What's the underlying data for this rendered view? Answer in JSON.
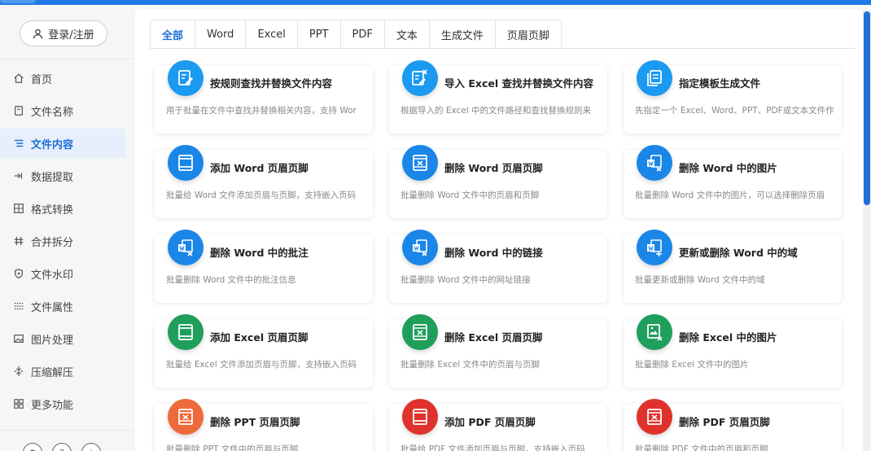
{
  "sidebar": {
    "login_label": "登录/注册",
    "items": [
      {
        "label": "首页",
        "icon": "home-icon",
        "active": false
      },
      {
        "label": "文件名称",
        "icon": "file-icon",
        "active": false
      },
      {
        "label": "文件内容",
        "icon": "list-icon",
        "active": true
      },
      {
        "label": "数据提取",
        "icon": "extract-icon",
        "active": false
      },
      {
        "label": "格式转换",
        "icon": "grid-icon",
        "active": false
      },
      {
        "label": "合并拆分",
        "icon": "hash-icon",
        "active": false
      },
      {
        "label": "文件水印",
        "icon": "shield-icon",
        "active": false
      },
      {
        "label": "文件属性",
        "icon": "lines-icon",
        "active": false
      },
      {
        "label": "图片处理",
        "icon": "image-icon",
        "active": false
      },
      {
        "label": "压缩解压",
        "icon": "compress-icon",
        "active": false
      },
      {
        "label": "更多功能",
        "icon": "more-icon",
        "active": false
      }
    ]
  },
  "tabs": [
    {
      "label": "全部",
      "active": true
    },
    {
      "label": "Word",
      "active": false
    },
    {
      "label": "Excel",
      "active": false
    },
    {
      "label": "PPT",
      "active": false
    },
    {
      "label": "PDF",
      "active": false
    },
    {
      "label": "文本",
      "active": false
    },
    {
      "label": "生成文件",
      "active": false
    },
    {
      "label": "页眉页脚",
      "active": false
    }
  ],
  "cards": [
    {
      "title": "按规则查找并替换文件内容",
      "desc": "用于批量在文件中查找并替换相关内容，支持 Wor",
      "color": "#1a9af0",
      "icon": "edit-doc-icon"
    },
    {
      "title": "导入 Excel 查找并替换文件内容",
      "desc": "根据导入的 Excel 中的文件路径和查找替换规则来",
      "color": "#1a9af0",
      "icon": "excel-edit-icon"
    },
    {
      "title": "指定模板生成文件",
      "desc": "先指定一个 Excel、Word、PPT、PDF或文本文件作",
      "color": "#1a9af0",
      "icon": "template-icon"
    },
    {
      "title": "添加 Word 页眉页脚",
      "desc": "批量给 Word 文件添加页眉与页脚，支持嵌入页码",
      "color": "#1a86e8",
      "icon": "header-footer-icon"
    },
    {
      "title": "删除 Word 页眉页脚",
      "desc": "批量删除 Word 文件中的页眉和页脚",
      "color": "#1a86e8",
      "icon": "delete-header-icon"
    },
    {
      "title": "删除 Word 中的图片",
      "desc": "批量删除 Word 文件中的图片，可以选择删除页眉",
      "color": "#1a86e8",
      "icon": "word-delete-image-icon"
    },
    {
      "title": "删除 Word 中的批注",
      "desc": "批量删除 Word 文件中的批注信息",
      "color": "#1a86e8",
      "icon": "word-delete-comment-icon"
    },
    {
      "title": "删除 Word 中的链接",
      "desc": "批量删除 Word 文件中的网址链接",
      "color": "#1a86e8",
      "icon": "word-delete-link-icon"
    },
    {
      "title": "更新或删除 Word 中的域",
      "desc": "批量更新或删除 Word 文件中的域",
      "color": "#1a86e8",
      "icon": "word-field-icon"
    },
    {
      "title": "添加 Excel 页眉页脚",
      "desc": "批量给 Excel 文件添加页眉与页脚，支持嵌入页码",
      "color": "#1f9e5c",
      "icon": "header-footer-icon"
    },
    {
      "title": "删除 Excel 页眉页脚",
      "desc": "批量删除 Excel 文件中的页眉与页脚",
      "color": "#1f9e5c",
      "icon": "delete-header-icon"
    },
    {
      "title": "删除 Excel 中的图片",
      "desc": "批量删除 Excel 文件中的图片",
      "color": "#1f9e5c",
      "icon": "excel-delete-image-icon"
    },
    {
      "title": "删除 PPT 页眉页脚",
      "desc": "批量删除 PPT 文件中的页眉与页脚",
      "color": "#ef6a3a",
      "icon": "delete-header-icon"
    },
    {
      "title": "添加 PDF 页眉页脚",
      "desc": "批量给 PDF 文件添加页眉与页脚，支持嵌入页码",
      "color": "#e0322c",
      "icon": "header-footer-icon"
    },
    {
      "title": "删除 PDF 页眉页脚",
      "desc": "批量删除 PDF 文件中的页眉和页脚",
      "color": "#e0322c",
      "icon": "delete-header-icon"
    }
  ]
}
